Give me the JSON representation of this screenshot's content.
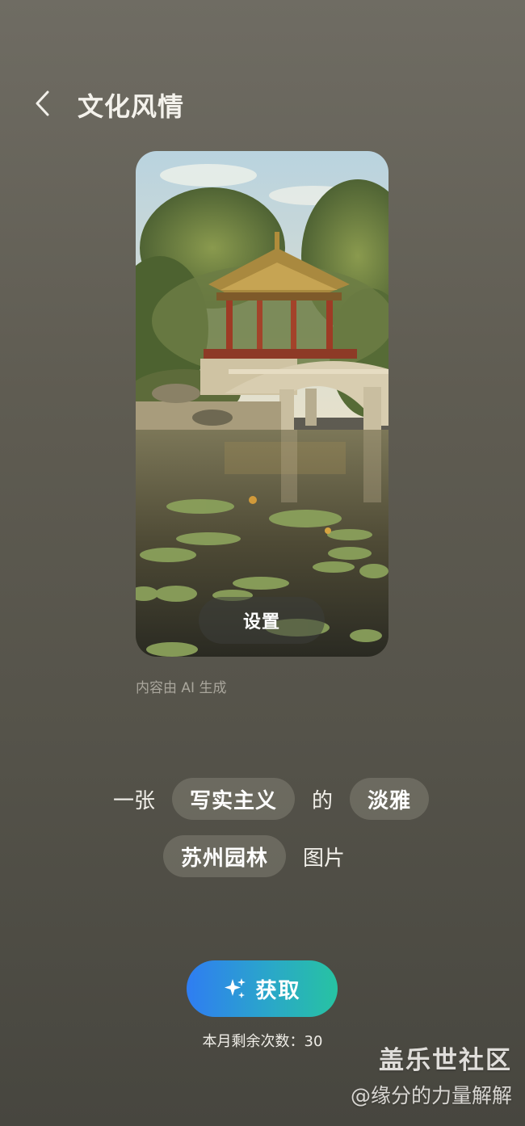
{
  "header": {
    "back_icon": "chevron-left-icon",
    "title": "文化风情"
  },
  "preview": {
    "image_subject": "苏州园林",
    "set_label": "设置",
    "ai_note": "内容由 AI 生成"
  },
  "prompt": {
    "word_1": "一张",
    "chip_style": "写实主义",
    "word_2": "的",
    "chip_tone": "淡雅",
    "chip_subject": "苏州园林",
    "word_3": "图片"
  },
  "action": {
    "icon": "sparkle-icon",
    "get_label": "获取",
    "quota_text": "本月剩余次数：30"
  },
  "watermark": {
    "title": "盖乐世社区",
    "user": "@缘分的力量解解"
  },
  "colors": {
    "button_gradient_start": "#2f7df2",
    "button_gradient_end": "#27c3a2",
    "background_top": "#6f6c63",
    "background_bottom": "#47463f"
  }
}
